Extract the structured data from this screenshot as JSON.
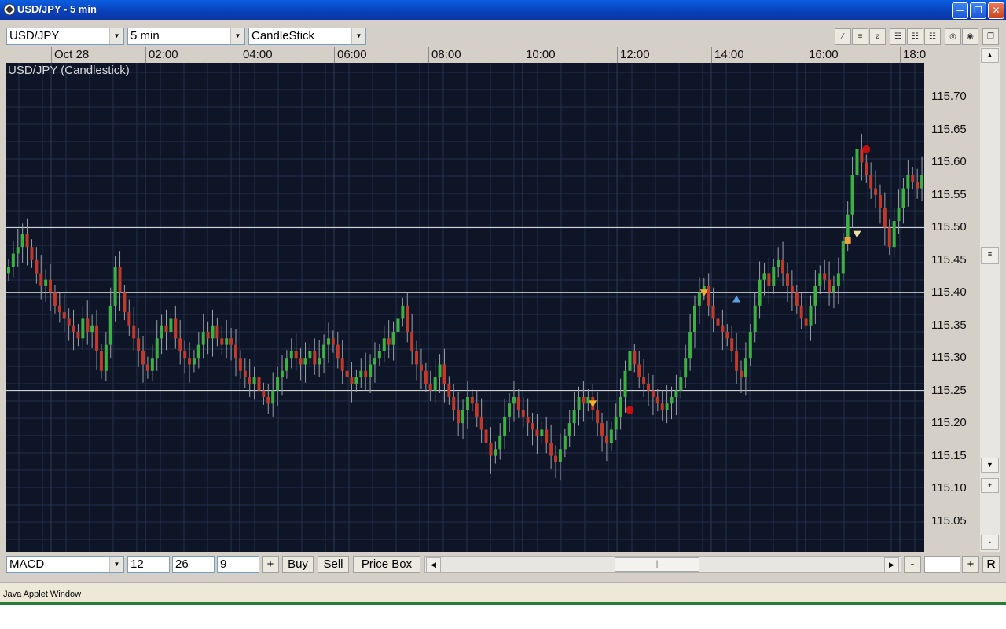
{
  "window": {
    "title": "USD/JPY - 5 min"
  },
  "toolbar": {
    "symbol": "USD/JPY",
    "interval": "5 min",
    "chart_type": "CandleStick"
  },
  "chart": {
    "label": "USD/JPY (Candlestick)",
    "time_labels": [
      "Oct 28",
      "02:00",
      "04:00",
      "06:00",
      "08:00",
      "10:00",
      "12:00",
      "14:00",
      "16:00",
      "18:0"
    ],
    "price_labels": [
      "115.70",
      "115.65",
      "115.60",
      "115.55",
      "115.50",
      "115.45",
      "115.40",
      "115.35",
      "115.30",
      "115.25",
      "115.20",
      "115.15",
      "115.10",
      "115.05"
    ],
    "horizontal_lines": [
      115.5,
      115.4,
      115.25
    ],
    "colors": {
      "background": "#0d1526",
      "grid": "#24304a",
      "up": "#3cb043",
      "down": "#c0392b",
      "line": "#e8e8e8"
    }
  },
  "indicator": {
    "name": "MACD",
    "p1": "12",
    "p2": "26",
    "p3": "9"
  },
  "buttons": {
    "plus": "+",
    "buy": "Buy",
    "sell": "Sell",
    "price_box": "Price Box",
    "minus": "-",
    "zoom_plus": "+",
    "reset": "R"
  },
  "status": {
    "text": "Java Applet Window"
  },
  "chart_data": {
    "type": "candlestick",
    "title": "USD/JPY (Candlestick)",
    "ylim": [
      115.0,
      115.75
    ],
    "series": [
      {
        "close": [
          115.44,
          115.46,
          115.47,
          115.49,
          115.47,
          115.45,
          115.43,
          115.41,
          115.42,
          115.4,
          115.38,
          115.37,
          115.36,
          115.35,
          115.34,
          115.33,
          115.36,
          115.34,
          115.35,
          115.31,
          115.28,
          115.32,
          115.38,
          115.44,
          115.4,
          115.37,
          115.35,
          115.33,
          115.31,
          115.29,
          115.28,
          115.3,
          115.33,
          115.35,
          115.34,
          115.36,
          115.33,
          115.31,
          115.3,
          115.29,
          115.3,
          115.32,
          115.34,
          115.33,
          115.35,
          115.33,
          115.32,
          115.33,
          115.32,
          115.3,
          115.28,
          115.27,
          115.26,
          115.27,
          115.25,
          115.24,
          115.23,
          115.25,
          115.27,
          115.28,
          115.3,
          115.31,
          115.3,
          115.29,
          115.3,
          115.31,
          115.29,
          115.3,
          115.32,
          115.33,
          115.32,
          115.3,
          115.28,
          115.27,
          115.26,
          115.27,
          115.28,
          115.27,
          115.29,
          115.3,
          115.31,
          115.33,
          115.32,
          115.34,
          115.36,
          115.38,
          115.34,
          115.31,
          115.29,
          115.28,
          115.26,
          115.25,
          115.27,
          115.29,
          115.26,
          115.24,
          115.22,
          115.2,
          115.22,
          115.24,
          115.23,
          115.21,
          115.19,
          115.17,
          115.15,
          115.16,
          115.18,
          115.21,
          115.23,
          115.24,
          115.22,
          115.21,
          115.2,
          115.19,
          115.18,
          115.19,
          115.17,
          115.15,
          115.14,
          115.16,
          115.18,
          115.2,
          115.22,
          115.24,
          115.23,
          115.24,
          115.22,
          115.2,
          115.18,
          115.17,
          115.19,
          115.21,
          115.24,
          115.28,
          115.31,
          115.29,
          115.27,
          115.26,
          115.25,
          115.24,
          115.23,
          115.22,
          115.23,
          115.24,
          115.25,
          115.27,
          115.3,
          115.34,
          115.38,
          115.4,
          115.41,
          115.38,
          115.36,
          115.35,
          115.34,
          115.33,
          115.31,
          115.28,
          115.27,
          115.3,
          115.34,
          115.38,
          115.42,
          115.43,
          115.41,
          115.44,
          115.45,
          115.43,
          115.41,
          115.4,
          115.38,
          115.36,
          115.35,
          115.38,
          115.41,
          115.43,
          115.42,
          115.4,
          115.41,
          115.43,
          115.48,
          115.52,
          115.58,
          115.62,
          115.6,
          115.58,
          115.56,
          115.55,
          115.53,
          115.5,
          115.47,
          115.51,
          115.53,
          115.56,
          115.58,
          115.57,
          115.56,
          115.58
        ]
      }
    ]
  }
}
